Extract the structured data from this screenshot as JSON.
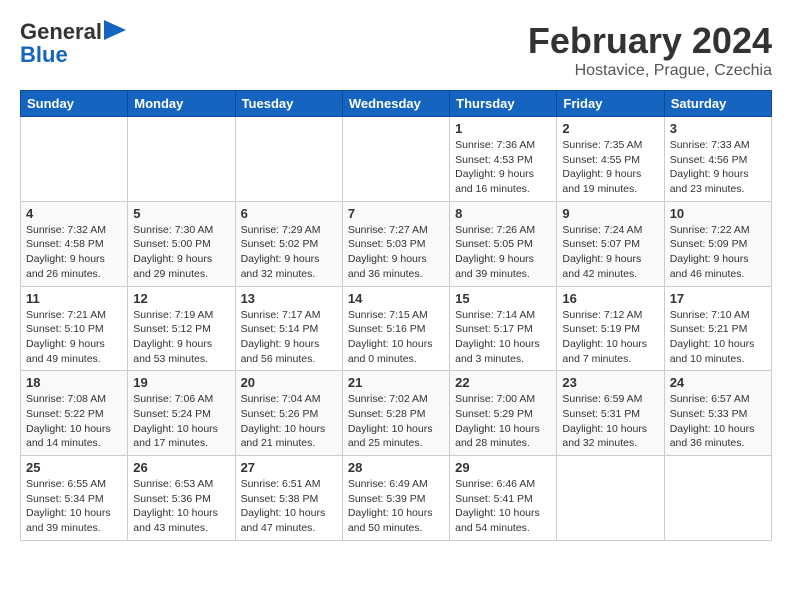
{
  "logo": {
    "line1": "General",
    "line2": "Blue"
  },
  "title": "February 2024",
  "subtitle": "Hostavice, Prague, Czechia",
  "weekdays": [
    "Sunday",
    "Monday",
    "Tuesday",
    "Wednesday",
    "Thursday",
    "Friday",
    "Saturday"
  ],
  "weeks": [
    [
      {
        "day": "",
        "info": ""
      },
      {
        "day": "",
        "info": ""
      },
      {
        "day": "",
        "info": ""
      },
      {
        "day": "",
        "info": ""
      },
      {
        "day": "1",
        "info": "Sunrise: 7:36 AM\nSunset: 4:53 PM\nDaylight: 9 hours\nand 16 minutes."
      },
      {
        "day": "2",
        "info": "Sunrise: 7:35 AM\nSunset: 4:55 PM\nDaylight: 9 hours\nand 19 minutes."
      },
      {
        "day": "3",
        "info": "Sunrise: 7:33 AM\nSunset: 4:56 PM\nDaylight: 9 hours\nand 23 minutes."
      }
    ],
    [
      {
        "day": "4",
        "info": "Sunrise: 7:32 AM\nSunset: 4:58 PM\nDaylight: 9 hours\nand 26 minutes."
      },
      {
        "day": "5",
        "info": "Sunrise: 7:30 AM\nSunset: 5:00 PM\nDaylight: 9 hours\nand 29 minutes."
      },
      {
        "day": "6",
        "info": "Sunrise: 7:29 AM\nSunset: 5:02 PM\nDaylight: 9 hours\nand 32 minutes."
      },
      {
        "day": "7",
        "info": "Sunrise: 7:27 AM\nSunset: 5:03 PM\nDaylight: 9 hours\nand 36 minutes."
      },
      {
        "day": "8",
        "info": "Sunrise: 7:26 AM\nSunset: 5:05 PM\nDaylight: 9 hours\nand 39 minutes."
      },
      {
        "day": "9",
        "info": "Sunrise: 7:24 AM\nSunset: 5:07 PM\nDaylight: 9 hours\nand 42 minutes."
      },
      {
        "day": "10",
        "info": "Sunrise: 7:22 AM\nSunset: 5:09 PM\nDaylight: 9 hours\nand 46 minutes."
      }
    ],
    [
      {
        "day": "11",
        "info": "Sunrise: 7:21 AM\nSunset: 5:10 PM\nDaylight: 9 hours\nand 49 minutes."
      },
      {
        "day": "12",
        "info": "Sunrise: 7:19 AM\nSunset: 5:12 PM\nDaylight: 9 hours\nand 53 minutes."
      },
      {
        "day": "13",
        "info": "Sunrise: 7:17 AM\nSunset: 5:14 PM\nDaylight: 9 hours\nand 56 minutes."
      },
      {
        "day": "14",
        "info": "Sunrise: 7:15 AM\nSunset: 5:16 PM\nDaylight: 10 hours\nand 0 minutes."
      },
      {
        "day": "15",
        "info": "Sunrise: 7:14 AM\nSunset: 5:17 PM\nDaylight: 10 hours\nand 3 minutes."
      },
      {
        "day": "16",
        "info": "Sunrise: 7:12 AM\nSunset: 5:19 PM\nDaylight: 10 hours\nand 7 minutes."
      },
      {
        "day": "17",
        "info": "Sunrise: 7:10 AM\nSunset: 5:21 PM\nDaylight: 10 hours\nand 10 minutes."
      }
    ],
    [
      {
        "day": "18",
        "info": "Sunrise: 7:08 AM\nSunset: 5:22 PM\nDaylight: 10 hours\nand 14 minutes."
      },
      {
        "day": "19",
        "info": "Sunrise: 7:06 AM\nSunset: 5:24 PM\nDaylight: 10 hours\nand 17 minutes."
      },
      {
        "day": "20",
        "info": "Sunrise: 7:04 AM\nSunset: 5:26 PM\nDaylight: 10 hours\nand 21 minutes."
      },
      {
        "day": "21",
        "info": "Sunrise: 7:02 AM\nSunset: 5:28 PM\nDaylight: 10 hours\nand 25 minutes."
      },
      {
        "day": "22",
        "info": "Sunrise: 7:00 AM\nSunset: 5:29 PM\nDaylight: 10 hours\nand 28 minutes."
      },
      {
        "day": "23",
        "info": "Sunrise: 6:59 AM\nSunset: 5:31 PM\nDaylight: 10 hours\nand 32 minutes."
      },
      {
        "day": "24",
        "info": "Sunrise: 6:57 AM\nSunset: 5:33 PM\nDaylight: 10 hours\nand 36 minutes."
      }
    ],
    [
      {
        "day": "25",
        "info": "Sunrise: 6:55 AM\nSunset: 5:34 PM\nDaylight: 10 hours\nand 39 minutes."
      },
      {
        "day": "26",
        "info": "Sunrise: 6:53 AM\nSunset: 5:36 PM\nDaylight: 10 hours\nand 43 minutes."
      },
      {
        "day": "27",
        "info": "Sunrise: 6:51 AM\nSunset: 5:38 PM\nDaylight: 10 hours\nand 47 minutes."
      },
      {
        "day": "28",
        "info": "Sunrise: 6:49 AM\nSunset: 5:39 PM\nDaylight: 10 hours\nand 50 minutes."
      },
      {
        "day": "29",
        "info": "Sunrise: 6:46 AM\nSunset: 5:41 PM\nDaylight: 10 hours\nand 54 minutes."
      },
      {
        "day": "",
        "info": ""
      },
      {
        "day": "",
        "info": ""
      }
    ]
  ]
}
